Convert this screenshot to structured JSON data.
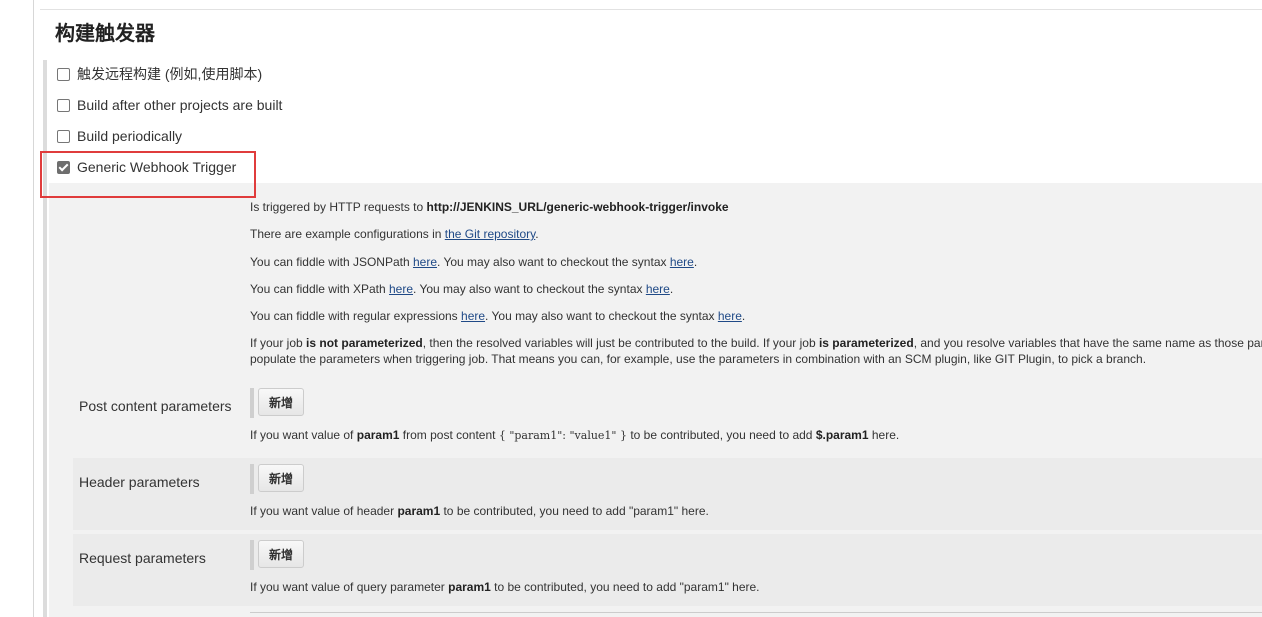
{
  "section": {
    "title": "构建触发器"
  },
  "triggers": [
    {
      "label": "触发远程构建 (例如,使用脚本)",
      "checked": false
    },
    {
      "label": "Build after other projects are built",
      "checked": false
    },
    {
      "label": "Build periodically",
      "checked": false
    },
    {
      "label": "Generic Webhook Trigger",
      "checked": true
    }
  ],
  "help": {
    "line1_prefix": "Is triggered by HTTP requests to ",
    "line1_url": "http://JENKINS_URL/generic-webhook-trigger/invoke",
    "line2_prefix": "There are example configurations in ",
    "line2_link": "the Git repository",
    "line2_suffix": ".",
    "line3_prefix": "You can fiddle with JSONPath ",
    "line3_link1": "here",
    "line3_mid": ". You may also want to checkout the syntax ",
    "line3_link2": "here",
    "line3_suffix": ".",
    "line4_prefix": "You can fiddle with XPath ",
    "line4_link1": "here",
    "line4_mid": ". You may also want to checkout the syntax ",
    "line4_link2": "here",
    "line4_suffix": ".",
    "line5_prefix": "You can fiddle with regular expressions ",
    "line5_link1": "here",
    "line5_mid": ". You may also want to checkout the syntax ",
    "line5_link2": "here",
    "line5_suffix": ".",
    "line6_a": "If your job ",
    "line6_b": "is not parameterized",
    "line6_c": ", then the resolved variables will just be contributed to the build. If your job ",
    "line6_d": "is parameterized",
    "line6_e": ", and you resolve variables that have the same name as those par",
    "line7": "populate the parameters when triggering job. That means you can, for example, use the parameters in combination with an SCM plugin, like GIT Plugin, to pick a branch."
  },
  "params": {
    "post": {
      "label": "Post content parameters",
      "button": "新增",
      "help_a": "If you want value of ",
      "help_b": "param1",
      "help_c": " from post content ",
      "help_code": "{ \"param1\": \"value1\" }",
      "help_d": " to be contributed, you need to add ",
      "help_e": "$.param1",
      "help_f": " here."
    },
    "header": {
      "label": "Header parameters",
      "button": "新增",
      "help_a": "If you want value of header ",
      "help_b": "param1",
      "help_c": " to be contributed, you need to add \"param1\" here."
    },
    "request": {
      "label": "Request parameters",
      "button": "新增",
      "help_a": "If you want value of query parameter ",
      "help_b": "param1",
      "help_c": " to be contributed, you need to add \"param1\" here."
    }
  },
  "colors": {
    "highlight": "#e03c3c",
    "link": "#204a87",
    "panel": "#f2f2f2"
  }
}
